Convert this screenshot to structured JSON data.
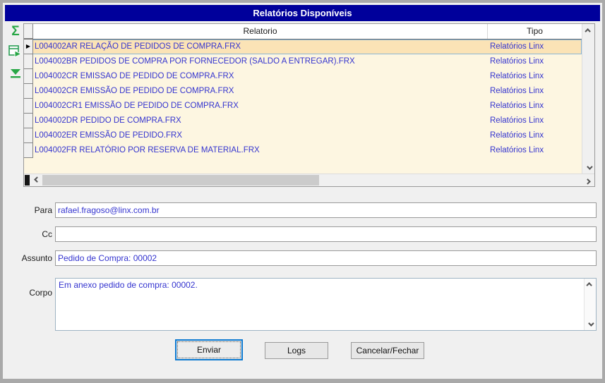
{
  "window": {
    "title": "Relatórios Disponíveis"
  },
  "toolbar": {
    "icons": [
      {
        "name": "sum-icon",
        "glyph": "Σ"
      },
      {
        "name": "run-report-icon"
      },
      {
        "name": "move-to-bottom-icon"
      }
    ]
  },
  "grid": {
    "columns": [
      {
        "label": "Relatorio"
      },
      {
        "label": "Tipo"
      }
    ],
    "rows": [
      {
        "relatorio": "L004002AR RELAÇÃO DE PEDIDOS DE COMPRA.FRX",
        "tipo": "Relatórios Linx",
        "selected": true
      },
      {
        "relatorio": "L004002BR PEDIDOS DE COMPRA POR FORNECEDOR (SALDO A ENTREGAR).FRX",
        "tipo": "Relatórios Linx",
        "selected": false
      },
      {
        "relatorio": "L004002CR EMISSAO DE PEDIDO DE COMPRA.FRX",
        "tipo": "Relatórios Linx",
        "selected": false
      },
      {
        "relatorio": "L004002CR EMISSÃO DE PEDIDO DE COMPRA.FRX",
        "tipo": "Relatórios Linx",
        "selected": false
      },
      {
        "relatorio": "L004002CR1 EMISSÃO DE PEDIDO DE COMPRA.FRX",
        "tipo": "Relatórios Linx",
        "selected": false
      },
      {
        "relatorio": "L004002DR PEDIDO DE COMPRA.FRX",
        "tipo": "Relatórios Linx",
        "selected": false
      },
      {
        "relatorio": "L004002ER EMISSÃO DE PEDIDO.FRX",
        "tipo": "Relatórios Linx",
        "selected": false
      },
      {
        "relatorio": "L004002FR RELATÓRIO POR RESERVA DE MATERIAL.FRX",
        "tipo": "Relatórios Linx",
        "selected": false
      }
    ]
  },
  "form": {
    "para": {
      "label": "Para",
      "value": "rafael.fragoso@linx.com.br"
    },
    "cc": {
      "label": "Cc",
      "value": ""
    },
    "assunto": {
      "label": "Assunto",
      "value": "Pedido de Compra: 00002"
    },
    "corpo": {
      "label": "Corpo",
      "value": "Em anexo pedido de compra: 00002."
    }
  },
  "buttons": {
    "enviar": "Enviar",
    "logs": "Logs",
    "cancelar": "Cancelar/Fechar"
  },
  "colors": {
    "titlebar": "#00009b",
    "title_text": "#ffffff",
    "grid_text_blue": "#3434cf",
    "row_bg": "#fdf6e1",
    "row_selected_bg": "#fbe3b6",
    "row_selected_border": "#8ab6d6",
    "icon_green": "#28a746",
    "default_button_border": "#0d7ad1",
    "frame_gray": "#a9a9a9"
  }
}
